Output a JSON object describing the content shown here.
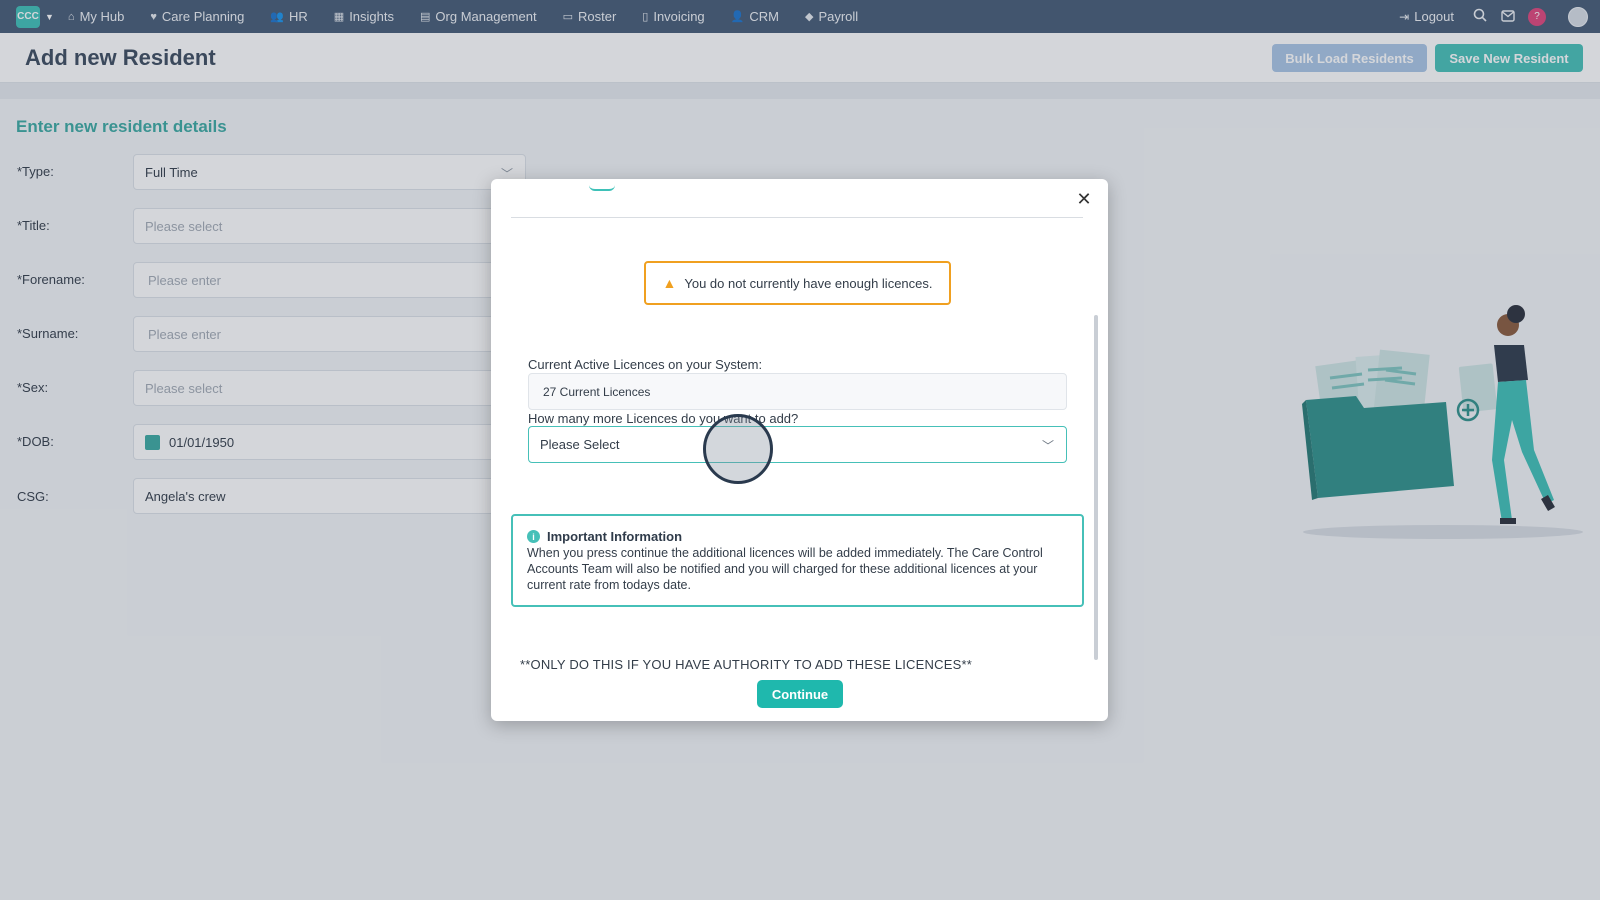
{
  "nav": {
    "logo": "CCC",
    "items": [
      {
        "label": "My Hub",
        "icon": "home-icon",
        "glyph": "⌂"
      },
      {
        "label": "Care Planning",
        "icon": "heart-icon",
        "glyph": "♥"
      },
      {
        "label": "HR",
        "icon": "people-icon",
        "glyph": "👥"
      },
      {
        "label": "Insights",
        "icon": "chart-icon",
        "glyph": "▦"
      },
      {
        "label": "Org Management",
        "icon": "building-icon",
        "glyph": "▤"
      },
      {
        "label": "Roster",
        "icon": "calendar-icon",
        "glyph": "▭"
      },
      {
        "label": "Invoicing",
        "icon": "document-icon",
        "glyph": "▯"
      },
      {
        "label": "CRM",
        "icon": "contacts-icon",
        "glyph": "👤"
      },
      {
        "label": "Payroll",
        "icon": "money-icon",
        "glyph": "◆"
      }
    ],
    "logout": "Logout",
    "help": "?"
  },
  "header": {
    "title": "Add new Resident",
    "bulk_label": "Bulk Load Residents",
    "save_label": "Save New Resident"
  },
  "form": {
    "title": "Enter new resident details",
    "fields": [
      {
        "label": "*Type:",
        "value": "Full Time"
      },
      {
        "label": "*Title:",
        "value": "Please select"
      },
      {
        "label": "*Forename:",
        "value": "Please enter"
      },
      {
        "label": "*Surname:",
        "value": "Please enter"
      },
      {
        "label": "*Sex:",
        "value": "Please select"
      },
      {
        "label": "*DOB:",
        "value": "01/01/1950"
      },
      {
        "label": "CSG:",
        "value": "Angela's crew"
      }
    ]
  },
  "modal": {
    "warning": "You do not currently have enough licences.",
    "current_label": "Current Active Licences on your System:",
    "current_value": "27 Current Licences",
    "more_label": "How many more Licences do you want to add?",
    "more_value": "Please Select",
    "info_title": "Important Information",
    "info_text": "When you press continue the additional licences will be added immediately. The Care Control Accounts Team will also be notified and you will charged for these additional licences at your current rate from todays date.",
    "authority": "**ONLY DO THIS IF YOU HAVE AUTHORITY TO ADD THESE LICENCES**",
    "continue_label": "Continue"
  },
  "colors": {
    "nav_bg": "#445a75",
    "accent": "#46c0b8",
    "warning": "#f0a020",
    "bulk_button": "#a9c6e6"
  }
}
